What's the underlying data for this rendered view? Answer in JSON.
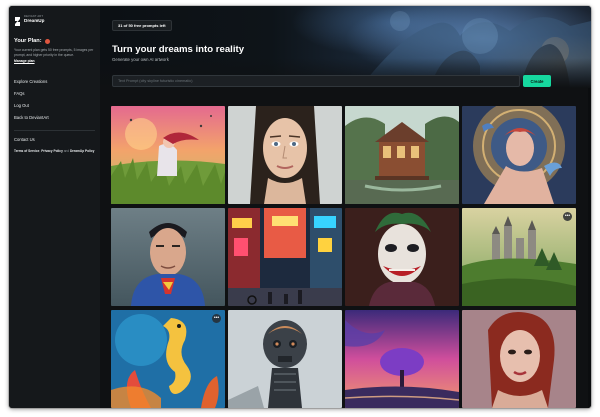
{
  "brand": {
    "top": "DEVIANT ART",
    "name": "DreamUp"
  },
  "plan": {
    "title": "Your Plan:",
    "description": "Your current plan gets 50 free prompts, 5 images per prompt, and higher priority in the queue.",
    "manage_label": "Manage plan"
  },
  "nav": {
    "items": [
      {
        "label": "Explore Creations"
      },
      {
        "label": "FAQs"
      },
      {
        "label": "Log Out"
      },
      {
        "label": "Back to DeviantArt"
      }
    ],
    "contact": "Contact Us",
    "terms": "Terms of Service",
    "privacy": "Privacy Policy",
    "and": "and",
    "dreamup_policy": "DreamUp Policy"
  },
  "header": {
    "prompts_left": "31 of 50 free prompts left",
    "title": "Turn your dreams into reality",
    "subtitle": "Generate your own AI artwork"
  },
  "prompt": {
    "placeholder": "Text Prompt (city skyline futuristic cinematic)",
    "value": "",
    "create_label": "Create"
  },
  "gallery": {
    "images": [
      {
        "subject": "girl-in-cornfield"
      },
      {
        "subject": "woman-portrait"
      },
      {
        "subject": "carousel-house"
      },
      {
        "subject": "woman-with-birds"
      },
      {
        "subject": "superman"
      },
      {
        "subject": "neon-street"
      },
      {
        "subject": "joker"
      },
      {
        "subject": "castle-on-hill"
      },
      {
        "subject": "seahorse"
      },
      {
        "subject": "robot"
      },
      {
        "subject": "pink-sky-tree"
      },
      {
        "subject": "woman-red-hair"
      }
    ],
    "more_icon": "more-icon"
  },
  "colors": {
    "accent": "#16d89f",
    "background": "#0f1113",
    "sidebar": "#15181b",
    "badge": "#e0563f"
  }
}
